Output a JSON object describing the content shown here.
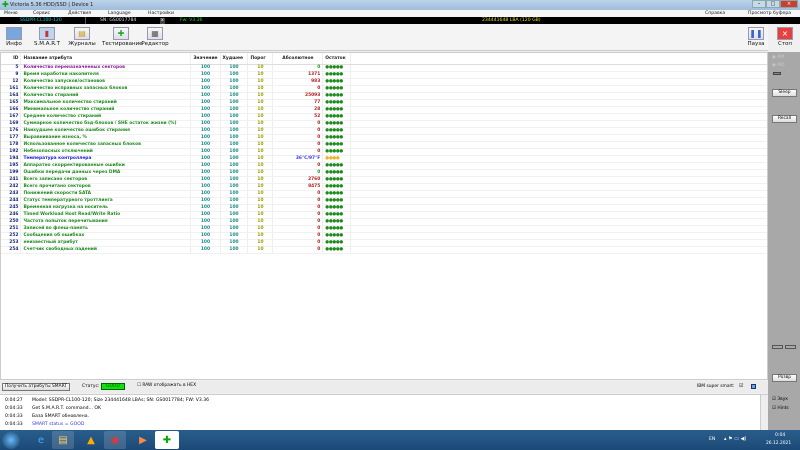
{
  "window": {
    "title": "Victoria 5.36 HDD/SSD | Device 1"
  },
  "menu": [
    "Меню",
    "Сервис",
    "Действия",
    "Language",
    "Настройки"
  ],
  "menu_right": {
    "help": "Справка",
    "clipboard": "Просмотр буфера"
  },
  "infobar": {
    "model": "SSDPR-CL100-120",
    "sn": "SN: GS0017784",
    "x": "x",
    "fw": "Fw: V3.36",
    "lba": "234441648 LBA (120 GB)"
  },
  "toolbar": {
    "info": "Инфо",
    "smart": "S.M.A.R.T",
    "logs": "Журналы",
    "test": "Тестирование",
    "editor": "Редактор",
    "pause": "Пауза",
    "stop": "Стоп"
  },
  "table": {
    "headers": {
      "id": "ID",
      "name": "Название атрибута",
      "value": "Значение",
      "worst": "Худшее",
      "threshold": "Порог",
      "raw": "Абсолютное",
      "remain": "Остаток"
    },
    "rows": [
      {
        "id": "5",
        "name": "Количество переназначенных секторов",
        "value": "100",
        "worst": "100",
        "threshold": "10",
        "raw": "0",
        "remain": "●●●●●",
        "name_color": "#8a1a9a",
        "raw_color": "#1a9a1a"
      },
      {
        "id": "9",
        "name": "Время наработки накопителя",
        "value": "100",
        "worst": "100",
        "threshold": "10",
        "raw": "1371",
        "remain": "●●●●●"
      },
      {
        "id": "12",
        "name": "Количество запусков/остановов",
        "value": "100",
        "worst": "100",
        "threshold": "10",
        "raw": "983",
        "remain": "●●●●●"
      },
      {
        "id": "161",
        "name": "Количество исправных запасных блоков",
        "value": "100",
        "worst": "100",
        "threshold": "10",
        "raw": "0",
        "remain": "●●●●●"
      },
      {
        "id": "164",
        "name": "Количество стираний",
        "value": "100",
        "worst": "100",
        "threshold": "10",
        "raw": "25093",
        "remain": "●●●●●"
      },
      {
        "id": "165",
        "name": "Максимальное количество стираний",
        "value": "100",
        "worst": "100",
        "threshold": "10",
        "raw": "77",
        "remain": "●●●●●"
      },
      {
        "id": "166",
        "name": "Минимальное количество стираний",
        "value": "100",
        "worst": "100",
        "threshold": "10",
        "raw": "28",
        "remain": "●●●●●"
      },
      {
        "id": "167",
        "name": "Среднее количество стираний",
        "value": "100",
        "worst": "100",
        "threshold": "10",
        "raw": "52",
        "remain": "●●●●●"
      },
      {
        "id": "169",
        "name": "Суммарное количество бэд-блоков / SHE остаток жизни (%)",
        "value": "100",
        "worst": "100",
        "threshold": "10",
        "raw": "0",
        "remain": "●●●●●"
      },
      {
        "id": "176",
        "name": "Наихудшее количество ошибок стирания",
        "value": "100",
        "worst": "100",
        "threshold": "10",
        "raw": "0",
        "remain": "●●●●●"
      },
      {
        "id": "177",
        "name": "Выравнивание износа, %",
        "value": "100",
        "worst": "100",
        "threshold": "10",
        "raw": "0",
        "remain": "●●●●●"
      },
      {
        "id": "178",
        "name": "Использованное количество запасных блоков",
        "value": "100",
        "worst": "100",
        "threshold": "10",
        "raw": "0",
        "remain": "●●●●●"
      },
      {
        "id": "192",
        "name": "Небезопасных отключений",
        "value": "100",
        "worst": "100",
        "threshold": "10",
        "raw": "0",
        "remain": "●●●●●"
      },
      {
        "id": "194",
        "name": "Температура контроллера",
        "value": "100",
        "worst": "100",
        "threshold": "10",
        "raw": "36°C/97°F",
        "remain": "●●●●",
        "name_color": "#1a1ae0",
        "raw_color": "#3a3ae0",
        "remain_color": "#f0b020"
      },
      {
        "id": "195",
        "name": "Аппаратно скорректированные ошибки",
        "value": "100",
        "worst": "100",
        "threshold": "10",
        "raw": "0",
        "remain": "●●●●●"
      },
      {
        "id": "199",
        "name": "Ошибки передачи данных через DMA",
        "value": "100",
        "worst": "100",
        "threshold": "10",
        "raw": "0",
        "remain": "●●●●●",
        "raw_color": "#1a9a1a"
      },
      {
        "id": "241",
        "name": "Всего записано секторов",
        "value": "100",
        "worst": "100",
        "threshold": "10",
        "raw": "2760",
        "remain": "●●●●●"
      },
      {
        "id": "242",
        "name": "Всего прочитано секторов",
        "value": "100",
        "worst": "100",
        "threshold": "10",
        "raw": "8475",
        "remain": "●●●●●"
      },
      {
        "id": "243",
        "name": "Понижений скорости SATA",
        "value": "100",
        "worst": "100",
        "threshold": "10",
        "raw": "0",
        "remain": "●●●●●"
      },
      {
        "id": "244",
        "name": "Статус температурного троттлинга",
        "value": "100",
        "worst": "100",
        "threshold": "10",
        "raw": "0",
        "remain": "●●●●●"
      },
      {
        "id": "245",
        "name": "Временная нагрузка на носитель",
        "value": "100",
        "worst": "100",
        "threshold": "10",
        "raw": "0",
        "remain": "●●●●●"
      },
      {
        "id": "246",
        "name": "Timed Workload Host Read/Write Ratio",
        "value": "100",
        "worst": "100",
        "threshold": "10",
        "raw": "0",
        "remain": "●●●●●"
      },
      {
        "id": "250",
        "name": "Частота попыток перечитывания",
        "value": "100",
        "worst": "100",
        "threshold": "10",
        "raw": "0",
        "remain": "●●●●●"
      },
      {
        "id": "251",
        "name": "Записей во флеш-память",
        "value": "100",
        "worst": "100",
        "threshold": "10",
        "raw": "0",
        "remain": "●●●●●"
      },
      {
        "id": "252",
        "name": "Сообщения об ошибках",
        "value": "100",
        "worst": "100",
        "threshold": "10",
        "raw": "0",
        "remain": "●●●●●"
      },
      {
        "id": "253",
        "name": "неизвестный атрибут",
        "value": "100",
        "worst": "100",
        "threshold": "10",
        "raw": "0",
        "remain": "●●●●●"
      },
      {
        "id": "254",
        "name": "Счетчик свободных падений",
        "value": "100",
        "worst": "100",
        "threshold": "10",
        "raw": "0",
        "remain": "●●●●●"
      }
    ]
  },
  "right_panel": {
    "api": "API",
    "pio": "PIO",
    "sleep": "Sleep",
    "recall": "Recall",
    "reset": "Розвр",
    "sound": "Звук",
    "hints": "Hints"
  },
  "bottom": {
    "get_smart": "Получить атрибуты SMART",
    "status_label": "Статус:",
    "status_value": "GOOD",
    "raw_hex": "RAW отображать в HEX",
    "ibm": "IBM super smart:"
  },
  "log": [
    {
      "time": "0:04:27",
      "msg": "Model: SSDPR-CL100-120; Size 234441648 LBAs; SN: GS0017784; FW: V3.36"
    },
    {
      "time": "0:04:33",
      "msg": "Get S.M.A.R.T. command... OK"
    },
    {
      "time": "0:04:33",
      "msg": "База SMART обновлена."
    },
    {
      "time": "0:04:33",
      "msg": "SMART status = GOOD",
      "color": "#3a3ae0"
    }
  ],
  "taskbar": {
    "lang": "EN",
    "time": "0:04",
    "date": "26.12.2021"
  }
}
